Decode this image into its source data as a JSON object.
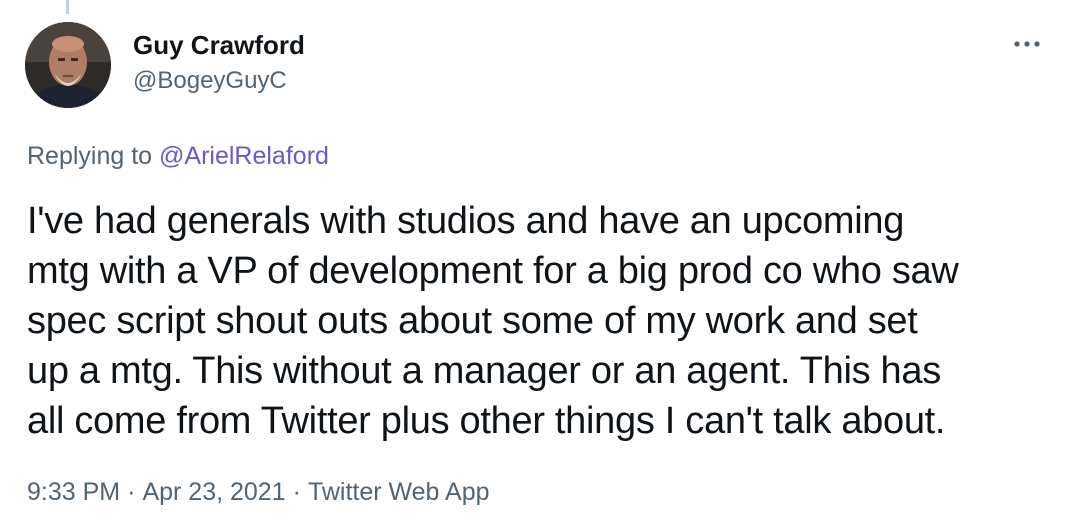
{
  "tweet": {
    "author": {
      "display_name": "Guy Crawford",
      "handle": "@BogeyGuyC",
      "avatar_icon": "profile-photo"
    },
    "more_icon": "ellipsis-icon",
    "replying": {
      "prefix": "Replying to ",
      "mention": "@ArielRelaford"
    },
    "text": "I've had generals with studios and have an upcoming\nmtg with a VP of development for a big prod co who saw\nspec script shout outs about some of my work and set\nup a mtg.  This without a manager or an agent. This has\nall come from Twitter plus other things I can't talk about.",
    "meta": {
      "time": "9:33 PM",
      "separator": "·",
      "date": "Apr 23, 2021",
      "source": "Twitter Web App"
    }
  },
  "colors": {
    "text": "#0f1419",
    "secondary": "#536471",
    "mention": "#6e57c6",
    "thread_line": "#c4cfd6"
  }
}
